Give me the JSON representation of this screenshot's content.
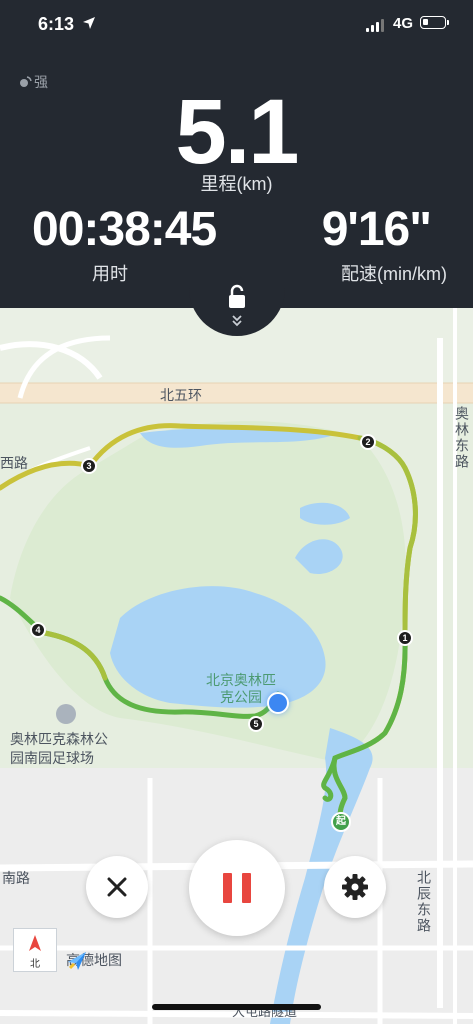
{
  "status_bar": {
    "time": "6:13",
    "network": "4G"
  },
  "gps": {
    "signal_label": "强"
  },
  "stats": {
    "distance": {
      "value": "5.1",
      "label": "里程(km)"
    },
    "duration": {
      "value": "00:38:45",
      "label": "用时"
    },
    "pace": {
      "value": "9'16\"",
      "label": "配速(min/km)"
    }
  },
  "map": {
    "road_labels": {
      "beiwuhuan": "北五环",
      "xi_lu": "西路",
      "aolin_donglu": "奥林东路",
      "nanlu": "南路",
      "beichen_donglu": "北辰东路",
      "dazhuang_tunnel": "大屯路隧道"
    },
    "park_label": "北京奥林匹克公园",
    "poi_label": "奥林匹克森林公园南园足球场",
    "brand_label": "高德地图",
    "compass_label": "北",
    "start_label": "起",
    "km_markers": [
      "1",
      "2",
      "3",
      "4",
      "5"
    ]
  },
  "colors": {
    "panel": "#242931",
    "pause_icon": "#e8463f",
    "route_green": "#5fb446",
    "route_yellow": "#c9c23a",
    "water": "#a9d3f5",
    "current_location": "#3c87f2"
  },
  "icons": [
    "location-arrow-icon",
    "signal-icon",
    "battery-icon",
    "gps-signal-icon",
    "lock-icon",
    "chevron-down-icon",
    "close-icon",
    "pause-icon",
    "gear-icon",
    "compass-icon",
    "amap-logo-icon"
  ]
}
